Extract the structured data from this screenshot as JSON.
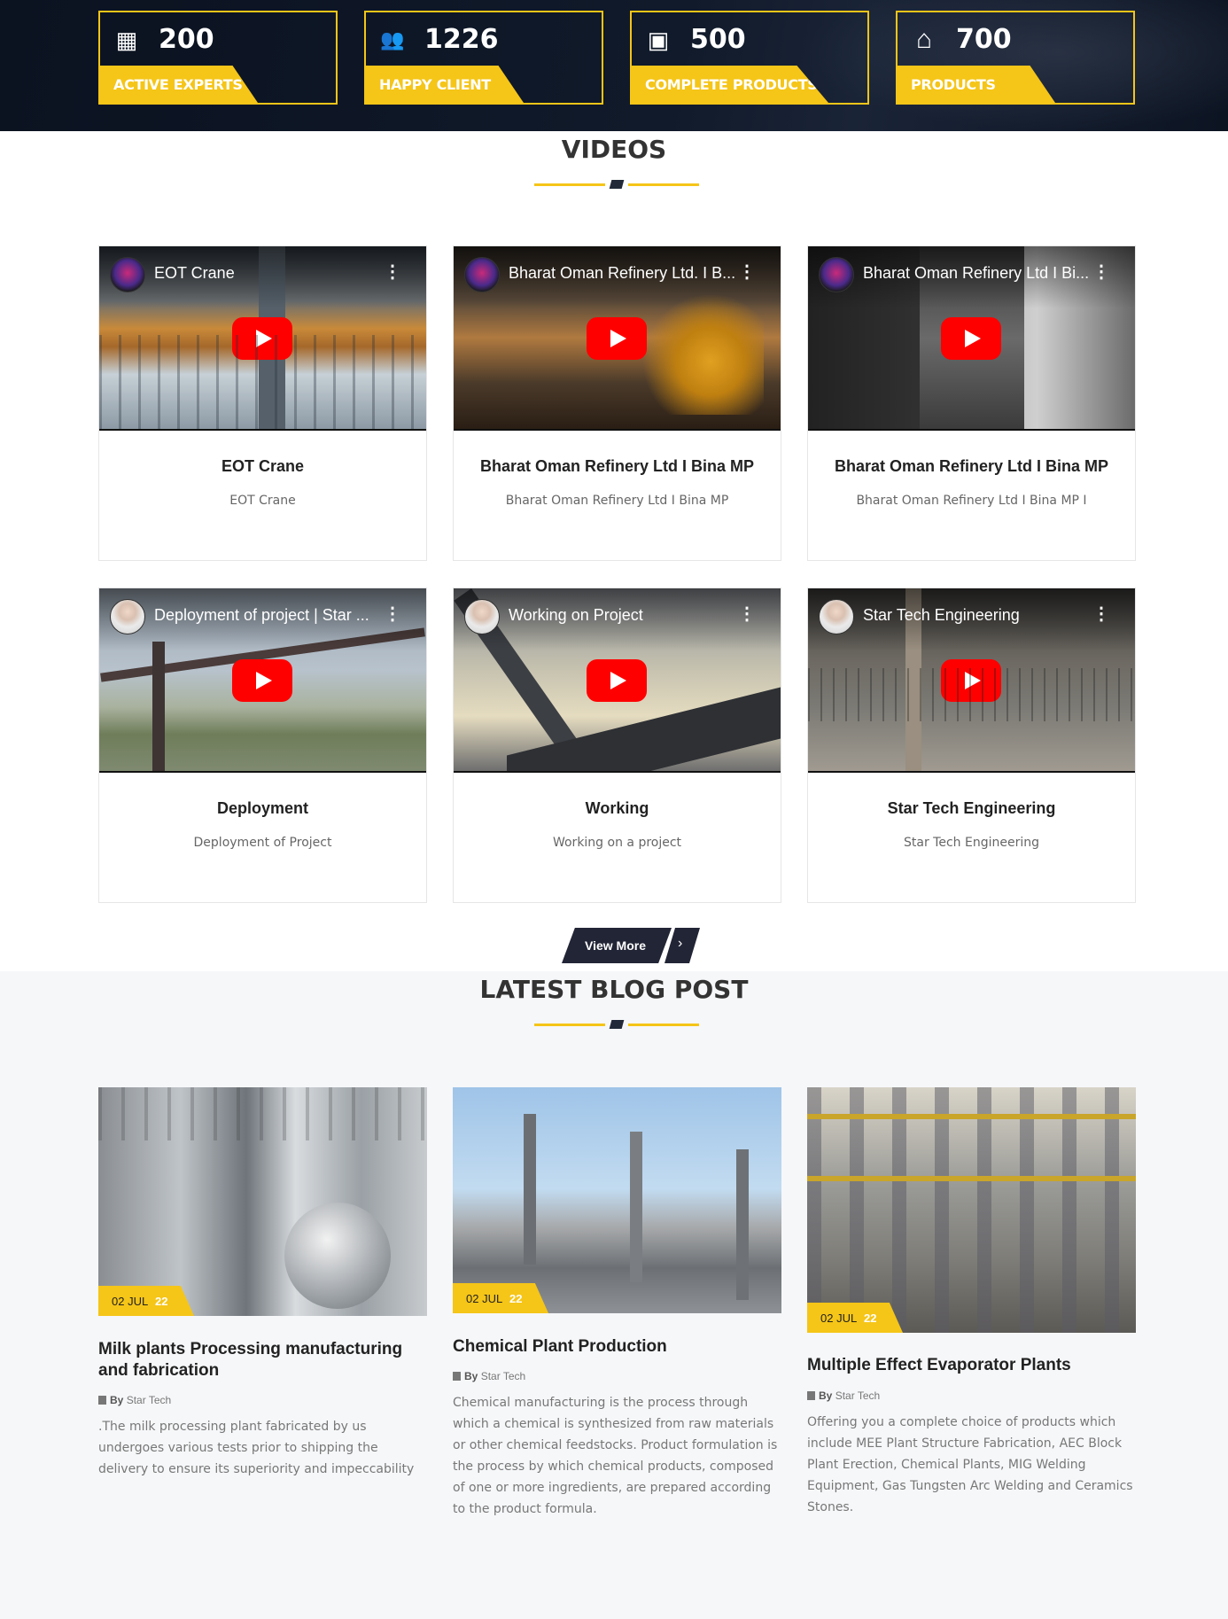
{
  "stats": [
    {
      "icon": "building-icon",
      "glyph": "▦",
      "value": "200",
      "label": "ACTIVE EXPERTS"
    },
    {
      "icon": "users-icon",
      "glyph": "👥",
      "value": "1226",
      "label": "HAPPY CLIENT"
    },
    {
      "icon": "products-icon",
      "glyph": "▣",
      "value": "500",
      "label": "COMPLETE PRODUCTS"
    },
    {
      "icon": "home-icon",
      "glyph": "⌂",
      "value": "700",
      "label": "PRODUCTS"
    }
  ],
  "videos": {
    "title": "VIDEOS",
    "items": [
      {
        "video_title": "EOT Crane",
        "title": "EOT Crane",
        "desc": "EOT Crane"
      },
      {
        "video_title": "Bharat Oman Refinery Ltd. I B...",
        "title": "Bharat Oman Refinery Ltd I Bina MP",
        "desc": "Bharat Oman Refinery Ltd I Bina MP"
      },
      {
        "video_title": "Bharat Oman Refinery Ltd I Bi...",
        "title": "Bharat Oman Refinery Ltd I Bina MP",
        "desc": "Bharat Oman Refinery Ltd I Bina MP I"
      },
      {
        "video_title": "Deployment of project | Star ...",
        "title": "Deployment",
        "desc": "Deployment of Project"
      },
      {
        "video_title": "Working on Project",
        "title": "Working",
        "desc": "Working on a project"
      },
      {
        "video_title": "Star Tech Engineering",
        "title": "Star Tech Engineering",
        "desc": "Star Tech Engineering"
      }
    ],
    "view_more": "View More",
    "view_more_arrow": "›"
  },
  "blog": {
    "title": "LATEST BLOG POST",
    "posts": [
      {
        "date": "02 JUL",
        "year": "22",
        "title": "Milk plants Processing manufacturing and fabrication",
        "by": "By",
        "author": "Star Tech",
        "excerpt": ".The milk processing plant fabricated by us undergoes various tests prior to shipping the delivery to ensure its superiority and impeccability"
      },
      {
        "date": "02 JUL",
        "year": "22",
        "title": "Chemical Plant Production",
        "by": "By",
        "author": "Star Tech",
        "excerpt": "Chemical manufacturing is the process through which a chemical is synthesized from raw materials or other chemical feedstocks. Product formulation is the process by which chemical products, composed of one or more ingredients, are prepared according to the product formula."
      },
      {
        "date": "02 JUL",
        "year": "22",
        "title": "Multiple Effect Evaporator Plants",
        "by": "By",
        "author": "Star Tech",
        "excerpt": "Offering you a complete choice of products which include MEE Plant Structure Fabrication, AEC Block Plant Erection, Chemical Plants, MIG Welding Equipment, Gas Tungsten Arc Welding and Ceramics Stones."
      }
    ]
  },
  "colors": {
    "accent": "#f5c518",
    "dark": "#222536",
    "play": "#ff0000"
  }
}
